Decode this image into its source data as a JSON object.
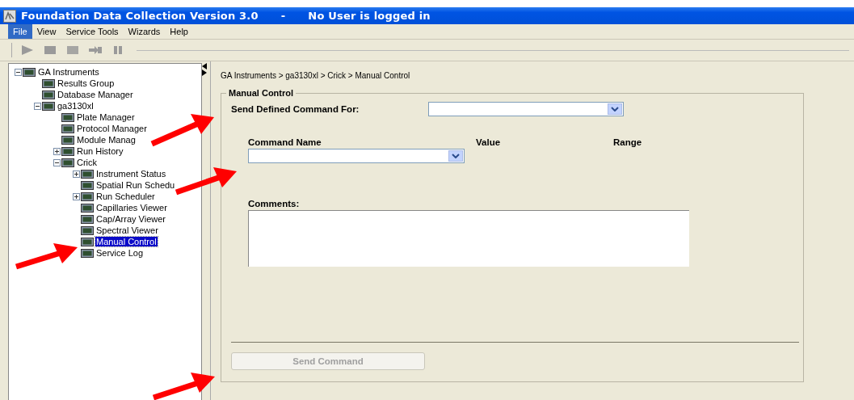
{
  "window": {
    "title": "Foundation Data Collection Version 3.0",
    "separator": "-",
    "user_status": "No User is logged in"
  },
  "menu": [
    {
      "label": "File",
      "selected": true
    },
    {
      "label": "View",
      "selected": false
    },
    {
      "label": "Service Tools",
      "selected": false
    },
    {
      "label": "Wizards",
      "selected": false
    },
    {
      "label": "Help",
      "selected": false
    }
  ],
  "toolbar": [
    {
      "kind": "play",
      "disabled": true
    },
    {
      "kind": "stop",
      "disabled": true
    },
    {
      "kind": "square",
      "disabled": true
    },
    {
      "kind": "skip",
      "disabled": true
    },
    {
      "kind": "pause",
      "disabled": true
    }
  ],
  "tree": [
    {
      "label": "GA Instruments",
      "expanded": true,
      "selected": false,
      "children": [
        {
          "label": "Results Group",
          "selected": false
        },
        {
          "label": "Database Manager",
          "selected": false
        },
        {
          "label": "ga3130xl",
          "expanded": true,
          "selected": false,
          "children": [
            {
              "label": "Plate Manager",
              "selected": false
            },
            {
              "label": "Protocol Manager",
              "selected": false
            },
            {
              "label": "Module Manag",
              "selected": false
            },
            {
              "label": "Run History",
              "expanded": false,
              "selected": false
            },
            {
              "label": "Crick",
              "expanded": true,
              "selected": false,
              "children": [
                {
                  "label": "Instrument Status",
                  "expanded": false,
                  "selected": false
                },
                {
                  "label": "Spatial Run Schedu",
                  "selected": false
                },
                {
                  "label": "Run Scheduler",
                  "expanded": false,
                  "selected": false
                },
                {
                  "label": "Capillaries Viewer",
                  "selected": false
                },
                {
                  "label": "Cap/Array Viewer",
                  "selected": false
                },
                {
                  "label": "Spectral Viewer",
                  "selected": false
                },
                {
                  "label": "Manual Control",
                  "selected": true
                },
                {
                  "label": "Service Log",
                  "selected": false
                }
              ]
            }
          ]
        }
      ]
    }
  ],
  "breadcrumb": "GA Instruments > ga3130xl > Crick > Manual Control",
  "manual_control": {
    "title": "Manual Control",
    "target_label": "Send Defined Command For:",
    "columns": [
      "Command Name",
      "Value",
      "Range"
    ],
    "comments_label": "Comments:",
    "send_button": {
      "label": "Send Command",
      "disabled": true
    }
  }
}
